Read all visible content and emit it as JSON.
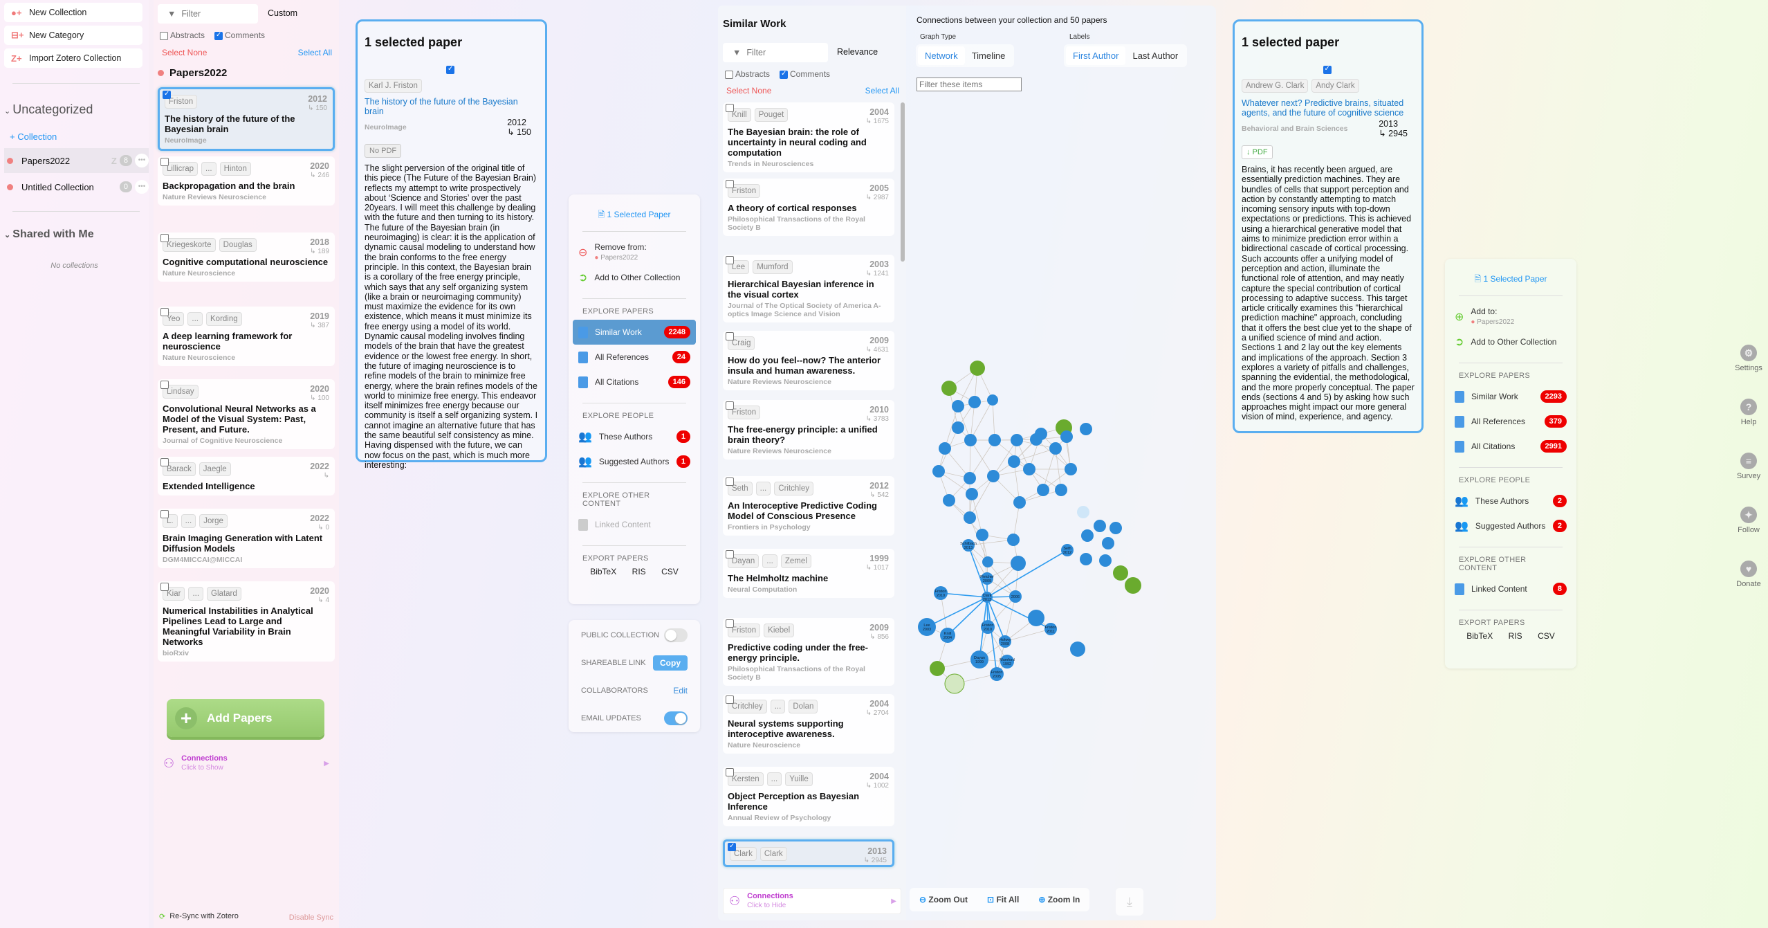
{
  "sidebar": {
    "buttons": [
      {
        "label": "New Collection",
        "icon": "new-collection-icon"
      },
      {
        "label": "New Category",
        "icon": "new-category-icon"
      },
      {
        "label": "Import Zotero Collection",
        "icon": "zotero-import-icon"
      }
    ],
    "uncategorized_label": "Uncategorized",
    "add_collection_label": "+ Collection",
    "collections": [
      {
        "name": "Papers2022",
        "zotero": "Z",
        "count": "8"
      },
      {
        "name": "Untitled Collection",
        "count": "0"
      }
    ],
    "shared_label": "Shared with Me",
    "no_collections": "No collections"
  },
  "collection_panel": {
    "filter_placeholder": "Filter",
    "sort": "Custom",
    "abstracts_label": "Abstracts",
    "comments_label": "Comments",
    "select_none": "Select None",
    "select_all": "Select All",
    "title": "Papers2022",
    "papers": [
      {
        "authors": [
          "Friston"
        ],
        "year": "2012",
        "cites": "↳ 150",
        "title": "The history of the future of the Bayesian brain",
        "venue": "NeuroImage",
        "selected": true
      },
      {
        "authors": [
          "Lillicrap",
          "...",
          "Hinton"
        ],
        "year": "2020",
        "cites": "↳ 246",
        "title": "Backpropagation and the brain",
        "venue": "Nature Reviews Neuroscience"
      },
      {
        "authors": [
          "Kriegeskorte",
          "Douglas"
        ],
        "year": "2018",
        "cites": "↳ 189",
        "title": "Cognitive computational neuroscience",
        "venue": "Nature Neuroscience"
      },
      {
        "authors": [
          "Yeo",
          "...",
          "Kording"
        ],
        "year": "2019",
        "cites": "↳ 387",
        "title": "A deep learning framework for neuroscience",
        "venue": "Nature Neuroscience"
      },
      {
        "authors": [
          "Lindsay"
        ],
        "year": "2020",
        "cites": "↳ 100",
        "title": "Convolutional Neural Networks as a Model of the Visual System: Past, Present, and Future.",
        "venue": "Journal of Cognitive Neuroscience"
      },
      {
        "authors": [
          "Barack",
          "Jaegle"
        ],
        "year": "2022",
        "cites": "↳",
        "title": "Extended Intelligence",
        "venue": ""
      },
      {
        "authors": [
          "L.",
          "...",
          "Jorge"
        ],
        "year": "2022",
        "cites": "↳ 0",
        "title": "Brain Imaging Generation with Latent Diffusion Models",
        "venue": "DGM4MICCAI@MICCAI"
      },
      {
        "authors": [
          "Kiar",
          "...",
          "Glatard"
        ],
        "year": "2020",
        "cites": "↳ 4",
        "title": "Numerical Instabilities in Analytical Pipelines Lead to Large and Meaningful Variability in Brain Networks",
        "venue": "bioRxiv"
      }
    ],
    "add_papers": "Add Papers",
    "connections_title": "Connections",
    "connections_sub": "Click to Show",
    "resync": "Re-Sync with Zotero",
    "disable_sync": "Disable Sync"
  },
  "detail_left": {
    "heading": "1 selected paper",
    "author": "Karl J. Friston",
    "title": "The history of the future of the Bayesian brain",
    "venue": "NeuroImage",
    "year": "2012",
    "cites": "↳ 150",
    "pdf": "No PDF",
    "abstract": "The slight perversion of the original title of this piece (The Future of the Bayesian Brain) reflects my attempt to write prospectively about ‘Science and Stories’ over the past 20years. I will meet this challenge by dealing with the future and then turning to its history. The future of the Bayesian brain (in neuroimaging) is clear: it is the application of dynamic causal modeling to understand how the brain conforms to the free energy principle. In this context, the Bayesian brain is a corollary of the free energy principle, which says that any self organizing system (like a brain or neuroimaging community) must maximize the evidence for its own existence, which means it must minimize its free energy using a model of its world. Dynamic causal modeling involves finding models of the brain that have the greatest evidence or the lowest free energy. In short, the future of imaging neuroscience is to refine models of the brain to minimize free energy, where the brain refines models of the world to minimize free energy. This endeavor itself minimizes free energy because our community is itself a self organizing system. I cannot imagine an alternative future that has the same beautiful self consistency as mine. Having dispensed with the future, we can now focus on the past, which is much more interesting:"
  },
  "actions_left": {
    "selected": "1 Selected Paper",
    "remove_from": "Remove from:",
    "remove_collection": "Papers2022",
    "add_other": "Add to Other Collection",
    "explore_papers": "EXPLORE PAPERS",
    "similar": "Similar Work",
    "similar_count": "2248",
    "refs": "All References",
    "refs_count": "24",
    "cites": "All Citations",
    "cites_count": "146",
    "explore_people": "EXPLORE PEOPLE",
    "these_authors": "These Authors",
    "these_count": "1",
    "suggested": "Suggested Authors",
    "suggested_count": "1",
    "explore_other": "EXPLORE OTHER CONTENT",
    "linked": "Linked Content",
    "export": "EXPORT PAPERS",
    "bibtex": "BibTeX",
    "ris": "RIS",
    "csv": "CSV"
  },
  "settings": {
    "public": "PUBLIC COLLECTION",
    "public_on": false,
    "link": "SHAREABLE LINK",
    "copy": "Copy",
    "collab": "COLLABORATORS",
    "edit": "Edit",
    "email": "EMAIL UPDATES",
    "email_on": true
  },
  "similar_panel": {
    "title": "Similar Work",
    "filter_placeholder": "Filter",
    "sort": "Relevance",
    "abstracts_label": "Abstracts",
    "comments_label": "Comments",
    "select_none": "Select None",
    "select_all": "Select All",
    "papers": [
      {
        "authors": [
          "Knill",
          "Pouget"
        ],
        "year": "2004",
        "cites": "↳ 1675",
        "title": "The Bayesian brain: the role of uncertainty in neural coding and computation",
        "venue": "Trends in Neurosciences"
      },
      {
        "authors": [
          "Friston"
        ],
        "year": "2005",
        "cites": "↳ 2987",
        "title": "A theory of cortical responses",
        "venue": "Philosophical Transactions of the Royal Society B"
      },
      {
        "authors": [
          "Lee",
          "Mumford"
        ],
        "year": "2003",
        "cites": "↳ 1241",
        "title": "Hierarchical Bayesian inference in the visual cortex",
        "venue": "Journal of The Optical Society of America A-optics Image Science and Vision"
      },
      {
        "authors": [
          "Craig"
        ],
        "year": "2009",
        "cites": "↳ 4631",
        "title": "How do you feel--now? The anterior insula and human awareness.",
        "venue": "Nature Reviews Neuroscience"
      },
      {
        "authors": [
          "Friston"
        ],
        "year": "2010",
        "cites": "↳ 3783",
        "title": "The free-energy principle: a unified brain theory?",
        "venue": "Nature Reviews Neuroscience"
      },
      {
        "authors": [
          "Seth",
          "...",
          "Critchley"
        ],
        "year": "2012",
        "cites": "↳ 542",
        "title": "An Interoceptive Predictive Coding Model of Conscious Presence",
        "venue": "Frontiers in Psychology"
      },
      {
        "authors": [
          "Dayan",
          "...",
          "Zemel"
        ],
        "year": "1999",
        "cites": "↳ 1017",
        "title": "The Helmholtz machine",
        "venue": "Neural Computation"
      },
      {
        "authors": [
          "Friston",
          "Kiebel"
        ],
        "year": "2009",
        "cites": "↳ 856",
        "title": "Predictive coding under the free-energy principle.",
        "venue": "Philosophical Transactions of the Royal Society B"
      },
      {
        "authors": [
          "Critchley",
          "...",
          "Dolan"
        ],
        "year": "2004",
        "cites": "↳ 2704",
        "title": "Neural systems supporting interoceptive awareness.",
        "venue": "Nature Neuroscience"
      },
      {
        "authors": [
          "Kersten",
          "...",
          "Yuille"
        ],
        "year": "2004",
        "cites": "↳ 1002",
        "title": "Object Perception as Bayesian Inference",
        "venue": "Annual Review of Psychology"
      },
      {
        "authors": [
          "Clark",
          "Clark"
        ],
        "year": "2013",
        "cites": "↳ 2945",
        "title": "",
        "venue": "",
        "selected": true
      }
    ],
    "connections_title": "Connections",
    "connections_sub": "Click to Hide"
  },
  "graph": {
    "caption": "Connections between your collection and 50 papers",
    "graph_type_label": "Graph Type",
    "network": "Network",
    "timeline": "Timeline",
    "labels_label": "Labels",
    "first_author": "First Author",
    "last_author": "Last Author",
    "filter_placeholder": "Filter these items",
    "zoom_out": "Zoom Out",
    "fit_all": "Fit All",
    "zoom_in": "Zoom In",
    "nodes": [
      {
        "label": "Schilbach\n2013"
      },
      {
        "label": "Seth\n2012"
      },
      {
        "label": "Fletcher\n2009"
      },
      {
        "label": "Friston\n2010"
      },
      {
        "label": "Clark\n2013"
      },
      {
        "label": "2006"
      },
      {
        "label": "Lee\n2003"
      },
      {
        "label": "Knill\n2004"
      },
      {
        "label": "Friston\n2010"
      },
      {
        "label": "Hohwy\n2008"
      },
      {
        "label": "Friston\n2011"
      },
      {
        "label": "Dayan\n1999"
      },
      {
        "label": "Mumford\n1992"
      },
      {
        "label": "Friston\n2005"
      }
    ],
    "colors": {
      "paper": "#2d8bd8",
      "collection": "#6aab2e",
      "collection_light": "#d4e8c2",
      "edge": "#cfc8c0",
      "citation": "#2f9cef"
    }
  },
  "detail_right": {
    "heading": "1 selected paper",
    "authors": [
      "Andrew G. Clark",
      "Andy Clark"
    ],
    "title": "Whatever next? Predictive brains, situated agents, and the future of cognitive science",
    "venue": "Behavioral and Brain Sciences",
    "year": "2013",
    "cites": "↳ 2945",
    "pdf": "↓ PDF",
    "abstract": "Brains, it has recently been argued, are essentially prediction machines. They are bundles of cells that support perception and action by constantly attempting to match incoming sensory inputs with top-down expectations or predictions. This is achieved using a hierarchical generative model that aims to minimize prediction error within a bidirectional cascade of cortical processing. Such accounts offer a unifying model of perception and action, illuminate the functional role of attention, and may neatly capture the special contribution of cortical processing to adaptive success. This target article critically examines this \"hierarchical prediction machine\" approach, concluding that it offers the best clue yet to the shape of a unified science of mind and action. Sections 1 and 2 lay out the key elements and implications of the approach. Section 3 explores a variety of pitfalls and challenges, spanning the evidential, the methodological, and the more properly conceptual. The paper ends (sections 4 and 5) by asking how such approaches might impact our more general vision of mind, experience, and agency."
  },
  "actions_right": {
    "selected": "1 Selected Paper",
    "add_to": "Add to:",
    "add_collection": "Papers2022",
    "add_other": "Add to Other Collection",
    "explore_papers": "EXPLORE PAPERS",
    "similar": "Similar Work",
    "similar_count": "2293",
    "refs": "All References",
    "refs_count": "379",
    "cites": "All Citations",
    "cites_count": "2991",
    "explore_people": "EXPLORE PEOPLE",
    "these_authors": "These Authors",
    "these_count": "2",
    "suggested": "Suggested Authors",
    "suggested_count": "2",
    "explore_other": "EXPLORE OTHER CONTENT",
    "linked": "Linked Content",
    "linked_count": "8",
    "export": "EXPORT PAPERS",
    "bibtex": "BibTeX",
    "ris": "RIS",
    "csv": "CSV"
  },
  "rail": [
    {
      "label": "Settings",
      "icon": "⚙"
    },
    {
      "label": "Help",
      "icon": "?"
    },
    {
      "label": "Survey",
      "icon": "≡"
    },
    {
      "label": "Follow",
      "icon": "✦"
    },
    {
      "label": "Donate",
      "icon": "♥"
    }
  ]
}
